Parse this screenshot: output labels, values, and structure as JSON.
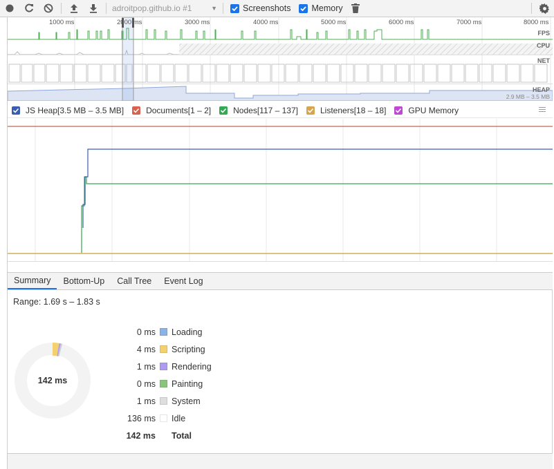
{
  "toolbar": {
    "record_icon": "record-icon",
    "reload_icon": "reload-icon",
    "clear_icon": "clear-icon",
    "upload_icon": "upload-icon",
    "download_icon": "download-icon",
    "profile_select": "adroitpop.github.io #1",
    "screenshots_label": "Screenshots",
    "memory_label": "Memory",
    "screenshots_checked": true,
    "memory_checked": true,
    "trash_icon": "trash-icon",
    "gear_icon": "gear-icon"
  },
  "overview": {
    "ruler": [
      "1000 ms",
      "2000 ms",
      "3000 ms",
      "4000 ms",
      "5000 ms",
      "6000 ms",
      "7000 ms",
      "8000 ms"
    ],
    "lanes": {
      "fps": "FPS",
      "cpu": "CPU",
      "net": "NET",
      "heap": "HEAP"
    },
    "heap_range": "2.9 MB – 3.5 MB"
  },
  "counters": [
    {
      "label": "JS Heap[3.5 MB – 3.5 MB]",
      "color": "#3b5db1"
    },
    {
      "label": "Documents[1 – 2]",
      "color": "#d8614f"
    },
    {
      "label": "Nodes[117 – 137]",
      "color": "#34a853"
    },
    {
      "label": "Listeners[18 – 18]",
      "color": "#d6a54d"
    },
    {
      "label": "GPU Memory",
      "color": "#c049d3"
    }
  ],
  "tabs": [
    "Summary",
    "Bottom-Up",
    "Call Tree",
    "Event Log"
  ],
  "summary": {
    "range": "Range: 1.69 s – 1.83 s",
    "total": "142 ms",
    "items": [
      {
        "value": "0 ms",
        "label": "Loading",
        "color": "#8ab4e8"
      },
      {
        "value": "4 ms",
        "label": "Scripting",
        "color": "#f4d06f"
      },
      {
        "value": "1 ms",
        "label": "Rendering",
        "color": "#af9bef"
      },
      {
        "value": "0 ms",
        "label": "Painting",
        "color": "#89c47c"
      },
      {
        "value": "1 ms",
        "label": "System",
        "color": "#dedede"
      },
      {
        "value": "136 ms",
        "label": "Idle",
        "color": "#ffffff"
      }
    ],
    "total_row": {
      "value": "142 ms",
      "label": "Total"
    }
  }
}
